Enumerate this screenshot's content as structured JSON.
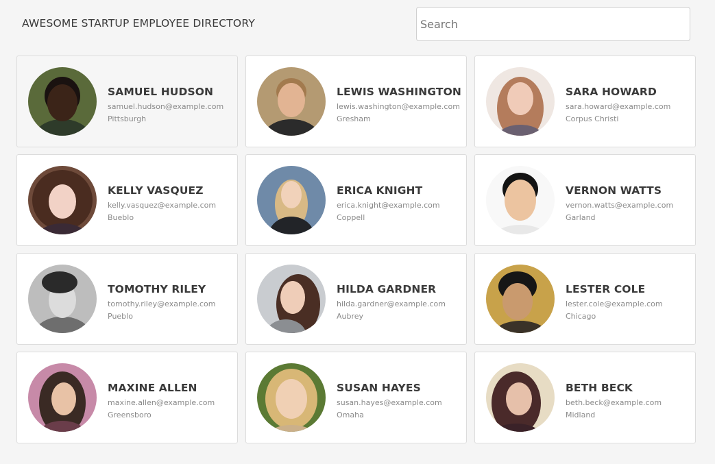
{
  "header": {
    "title": "AWESOME STARTUP EMPLOYEE DIRECTORY",
    "search_placeholder": "Search"
  },
  "employees": [
    {
      "name": "SAMUEL HUDSON",
      "email": "samuel.hudson@example.com",
      "city": "Pittsburgh",
      "avatar": {
        "bg": "#5a6a3a",
        "skin": "#3b2418",
        "hair": "#1a1210",
        "shirt": "#2e3b2a"
      }
    },
    {
      "name": "LEWIS WASHINGTON",
      "email": "lewis.washington@example.com",
      "city": "Gresham",
      "avatar": {
        "bg": "#b49a72",
        "skin": "#e2b493",
        "hair": "#a27a4e",
        "shirt": "#2b2b2b"
      }
    },
    {
      "name": "SARA HOWARD",
      "email": "sara.howard@example.com",
      "city": "Corpus Christi",
      "avatar": {
        "bg": "#efe7e2",
        "skin": "#f0cbb8",
        "hair": "#b47c5c",
        "shirt": "#6a6070"
      }
    },
    {
      "name": "KELLY VASQUEZ",
      "email": "kelly.vasquez@example.com",
      "city": "Bueblo",
      "avatar": {
        "bg": "#6e4a3a",
        "skin": "#f2d2c6",
        "hair": "#4a2c20",
        "shirt": "#3a2a35"
      }
    },
    {
      "name": "ERICA KNIGHT",
      "email": "erica.knight@example.com",
      "city": "Coppell",
      "avatar": {
        "bg": "#6f8aa8",
        "skin": "#f1d2ba",
        "hair": "#d8b985",
        "shirt": "#222428"
      }
    },
    {
      "name": "VERNON WATTS",
      "email": "vernon.watts@example.com",
      "city": "Garland",
      "avatar": {
        "bg": "#f8f8f8",
        "skin": "#ecc4a0",
        "hair": "#141414",
        "shirt": "#e8e8e8"
      }
    },
    {
      "name": "TOMOTHY RILEY",
      "email": "tomothy.riley@example.com",
      "city": "Pueblo",
      "avatar": {
        "bg": "#bdbdbd",
        "skin": "#dcdcdc",
        "hair": "#2a2a2a",
        "shirt": "#6e6e6e"
      }
    },
    {
      "name": "HILDA GARDNER",
      "email": "hilda.gardner@example.com",
      "city": "Aubrey",
      "avatar": {
        "bg": "#c9ccd0",
        "skin": "#efcdb8",
        "hair": "#4a2e24",
        "shirt": "#8b8e92"
      }
    },
    {
      "name": "LESTER COLE",
      "email": "lester.cole@example.com",
      "city": "Chicago",
      "avatar": {
        "bg": "#c8a24a",
        "skin": "#c99a6e",
        "hair": "#161616",
        "shirt": "#3a3228"
      }
    },
    {
      "name": "MAXINE ALLEN",
      "email": "maxine.allen@example.com",
      "city": "Greensboro",
      "avatar": {
        "bg": "#c78aa8",
        "skin": "#e8c2a6",
        "hair": "#3a2a24",
        "shirt": "#6a3d4a"
      }
    },
    {
      "name": "SUSAN HAYES",
      "email": "susan.hayes@example.com",
      "city": "Omaha",
      "avatar": {
        "bg": "#5b7a34",
        "skin": "#f0d0b4",
        "hair": "#d8b776",
        "shirt": "#cbb08a"
      }
    },
    {
      "name": "BETH BECK",
      "email": "beth.beck@example.com",
      "city": "Midland",
      "avatar": {
        "bg": "#e7dcc4",
        "skin": "#e6c0aa",
        "hair": "#4a2a2a",
        "shirt": "#3a2228"
      }
    }
  ]
}
